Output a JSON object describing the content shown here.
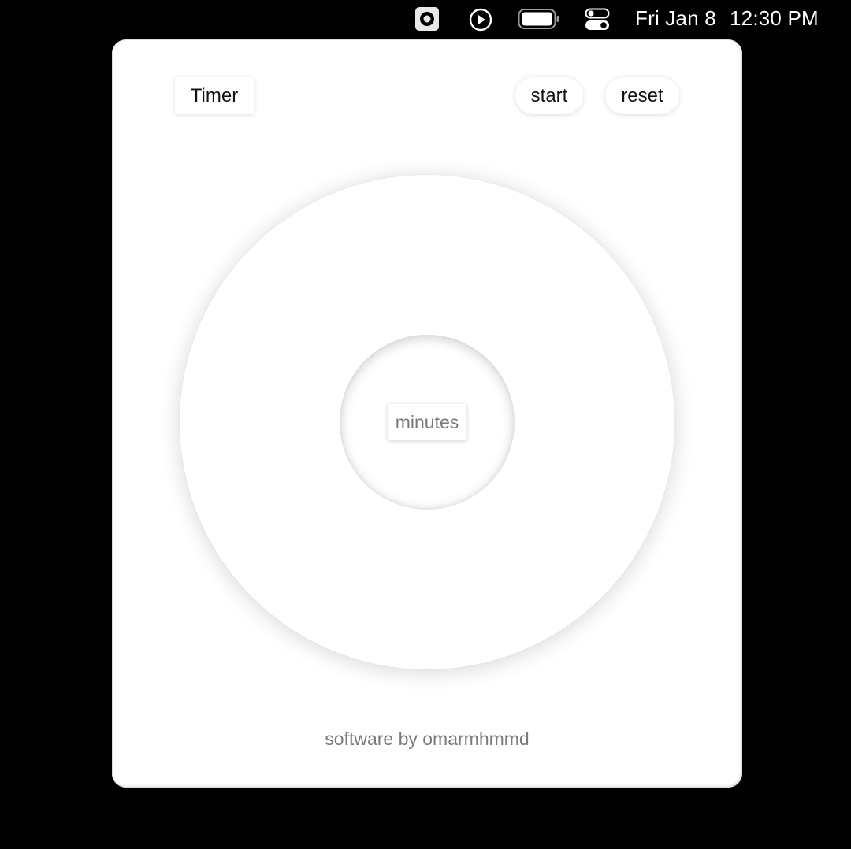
{
  "menubar": {
    "icons": [
      "record-stop-icon",
      "play-circle-icon",
      "battery-icon",
      "control-center-icon"
    ],
    "date": "Fri Jan 8",
    "time": "12:30 PM"
  },
  "app": {
    "title": "Timer",
    "start_label": "start",
    "reset_label": "reset",
    "minutes_label": "minutes",
    "footer": "software by omarmhmmd"
  }
}
